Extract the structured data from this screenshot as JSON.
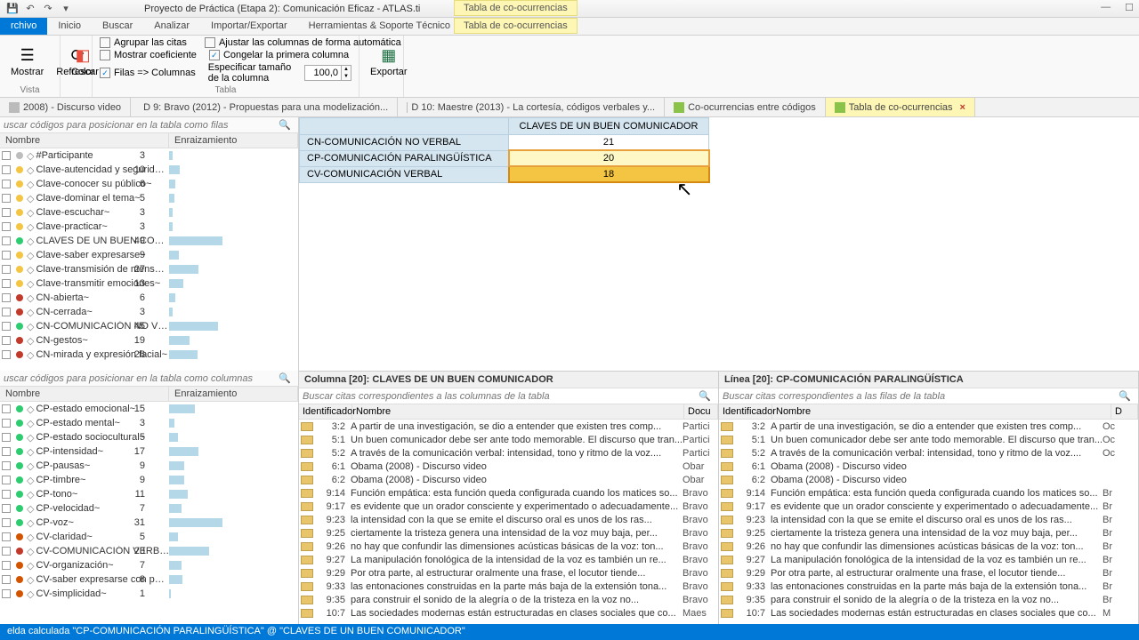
{
  "title": "Proyecto de Práctica (Etapa 2): Comunicación Eficaz - ATLAS.ti",
  "context_tab": "Tabla de co-ocurrencias",
  "menu": {
    "archivo": "rchivo",
    "inicio": "Inicio",
    "buscar": "Buscar",
    "analizar": "Analizar",
    "importar": "Importar/Exportar",
    "herramientas": "Herramientas & Soporte Técnico"
  },
  "ribbon": {
    "mostrar": "Mostrar",
    "vista": "Vista",
    "refrescar": "Refrescar",
    "color": "Color",
    "agrupar": "Agrupar las citas",
    "mostrar_coef": "Mostrar coeficiente",
    "filas_col": "Filas => Columnas",
    "ajustar": "Ajustar las columnas de forma automática",
    "congelar": "Congelar la primera columna",
    "especificar": "Especificar tamaño de la columna",
    "size": "100,0",
    "tabla": "Tabla",
    "exportar": "Exportar"
  },
  "doctabs": [
    "2008) - Discurso video",
    "D 9: Bravo (2012) - Propuestas para una modelización...",
    "D 10: Maestre (2013) - La cortesía, códigos verbales y...",
    "Co-ocurrencias entre códigos",
    "Tabla de co-ocurrencias"
  ],
  "search_rows_ph": "uscar códigos para posicionar en la tabla como filas",
  "search_cols_ph": "uscar códigos para posicionar en la tabla como columnas",
  "hdr_nombre": "Nombre",
  "hdr_enraiz": "Enraizamiento",
  "codes_top": [
    {
      "c": "#bdbdbd",
      "n": "#Participante",
      "v": 3
    },
    {
      "c": "#f4c542",
      "n": "Clave-autencidad y seguridad~",
      "v": 10
    },
    {
      "c": "#f4c542",
      "n": "Clave-conocer su público~",
      "v": 6
    },
    {
      "c": "#f4c542",
      "n": "Clave-dominar el tema~",
      "v": 5
    },
    {
      "c": "#f4c542",
      "n": "Clave-escuchar~",
      "v": 3
    },
    {
      "c": "#f4c542",
      "n": "Clave-practicar~",
      "v": 3
    },
    {
      "c": "#2ecc71",
      "n": "CLAVES DE UN BUEN COMU...",
      "v": 49
    },
    {
      "c": "#f4c542",
      "n": "Clave-saber expresarse~",
      "v": 9
    },
    {
      "c": "#f4c542",
      "n": "Clave-transmisión de mensaje~",
      "v": 27
    },
    {
      "c": "#f4c542",
      "n": "Clave-transmitir emociones~",
      "v": 13
    },
    {
      "c": "#c0392b",
      "n": "CN-abierta~",
      "v": 6
    },
    {
      "c": "#c0392b",
      "n": "CN-cerrada~",
      "v": 3
    },
    {
      "c": "#2ecc71",
      "n": "CN-COMUNICACIÓN NO VE...",
      "v": 45
    },
    {
      "c": "#c0392b",
      "n": "CN-gestos~",
      "v": 19
    },
    {
      "c": "#c0392b",
      "n": "CN-mirada y expresión facial~",
      "v": 26
    }
  ],
  "codes_bottom": [
    {
      "c": "#2ecc71",
      "n": "CP-estado emocional~",
      "v": 15
    },
    {
      "c": "#2ecc71",
      "n": "CP-estado mental~",
      "v": 3
    },
    {
      "c": "#2ecc71",
      "n": "CP-estado sociocultural~",
      "v": 5
    },
    {
      "c": "#2ecc71",
      "n": "CP-intensidad~",
      "v": 17
    },
    {
      "c": "#2ecc71",
      "n": "CP-pausas~",
      "v": 9
    },
    {
      "c": "#2ecc71",
      "n": "CP-timbre~",
      "v": 9
    },
    {
      "c": "#2ecc71",
      "n": "CP-tono~",
      "v": 11
    },
    {
      "c": "#2ecc71",
      "n": "CP-velocidad~",
      "v": 7
    },
    {
      "c": "#2ecc71",
      "n": "CP-voz~",
      "v": 31
    },
    {
      "c": "#d35400",
      "n": "CV-claridad~",
      "v": 5
    },
    {
      "c": "#c0392b",
      "n": "CV-COMUNICACIÓN VERBAL~",
      "v": 23
    },
    {
      "c": "#d35400",
      "n": "CV-organización~",
      "v": 7
    },
    {
      "c": "#d35400",
      "n": "CV-saber expresarse con pal...",
      "v": 8
    },
    {
      "c": "#d35400",
      "n": "CV-simplicidad~",
      "v": 1
    }
  ],
  "co_header": "CLAVES DE UN BUEN COMUNICADOR",
  "co_rows": [
    {
      "label": "CN-COMUNICACIÓN NO VERBAL",
      "val": "21",
      "cls": ""
    },
    {
      "label": "CP-COMUNICACIÓN PARALINGÜÍSTICA",
      "val": "20",
      "cls": "sel1"
    },
    {
      "label": "CV-COMUNICACIÓN VERBAL",
      "val": "18",
      "cls": "sel2"
    }
  ],
  "lp_left_title": "Columna [20]: CLAVES DE UN BUEN COMUNICADOR",
  "lp_right_title": "Línea [20]: CP-COMUNICACIÓN PARALINGÜÍSTICA",
  "lp_left_search": "Buscar citas correspondientes a las columnas de la tabla",
  "lp_right_search": "Buscar citas correspondientes a las filas de la tabla",
  "lp_hdr_id": "Identificador",
  "lp_hdr_nombre": "Nombre",
  "lp_hdr_doc": "Docu",
  "quotes_left": [
    {
      "id": "3:2",
      "n": "A partir de una investigación, se dio a entender que existen tres comp...",
      "d": "Partici"
    },
    {
      "id": "5:1",
      "n": "Un buen comunicador debe ser ante todo memorable. El discurso que tran...",
      "d": "Partici"
    },
    {
      "id": "5:2",
      "n": "A través de la comunicación verbal: intensidad, tono y ritmo de la voz....",
      "d": "Partici"
    },
    {
      "id": "6:1",
      "n": "Obama (2008) - Discurso video",
      "d": "Obar"
    },
    {
      "id": "6:2",
      "n": "Obama (2008) - Discurso video",
      "d": "Obar"
    },
    {
      "id": "9:14",
      "n": "Función empática: esta función queda configurada cuando los matices so...",
      "d": "Bravo"
    },
    {
      "id": "9:17",
      "n": "es evidente que un orador consciente y experimentado o  adecuadamente...",
      "d": "Bravo"
    },
    {
      "id": "9:23",
      "n": "la intensidad con la que se emite el discurso oral es  unos de los ras...",
      "d": "Bravo"
    },
    {
      "id": "9:25",
      "n": "ciertamente la tristeza genera una  intensidad de la voz muy baja, per...",
      "d": "Bravo"
    },
    {
      "id": "9:26",
      "n": "no hay que confundir las dimensiones acústicas básicas de la  voz: ton...",
      "d": "Bravo"
    },
    {
      "id": "9:27",
      "n": "La manipulación fonológica de la intensidad de la voz es también un re...",
      "d": "Bravo"
    },
    {
      "id": "9:29",
      "n": "Por otra parte, al estructurar oralmente una frase, el locutor tiende...",
      "d": "Bravo"
    },
    {
      "id": "9:33",
      "n": "las entonaciones construidas en la parte más baja de la extensión tona...",
      "d": "Bravo"
    },
    {
      "id": "9:35",
      "n": "para construir el sonido de la alegría o de la tristeza en la voz  no...",
      "d": "Bravo"
    },
    {
      "id": "10:7",
      "n": "Las sociedades modernas están estructuradas en clases sociales que co...",
      "d": "Maes"
    }
  ],
  "quotes_right": [
    {
      "id": "3:2",
      "n": "A partir de una investigación, se dio a entender que existen tres comp...",
      "d": "Oc"
    },
    {
      "id": "5:1",
      "n": "Un buen comunicador debe ser ante todo memorable. El discurso que tran...",
      "d": "Oc"
    },
    {
      "id": "5:2",
      "n": "A través de la comunicación verbal: intensidad, tono y ritmo de la voz....",
      "d": "Oc"
    },
    {
      "id": "6:1",
      "n": "Obama (2008) - Discurso video",
      "d": ""
    },
    {
      "id": "6:2",
      "n": "Obama (2008) - Discurso video",
      "d": ""
    },
    {
      "id": "9:14",
      "n": "Función empática: esta función queda configurada cuando los matices so...",
      "d": "Br"
    },
    {
      "id": "9:17",
      "n": "es evidente que un orador consciente y experimentado o  adecuadamente...",
      "d": "Br"
    },
    {
      "id": "9:23",
      "n": "la intensidad con la que se emite el discurso oral es  unos de los ras...",
      "d": "Br"
    },
    {
      "id": "9:25",
      "n": "ciertamente la tristeza genera una  intensidad de la voz muy baja, per...",
      "d": "Br"
    },
    {
      "id": "9:26",
      "n": "no hay que confundir las dimensiones acústicas básicas de la  voz: ton...",
      "d": "Br"
    },
    {
      "id": "9:27",
      "n": "La manipulación fonológica de la intensidad de la voz es también un re...",
      "d": "Br"
    },
    {
      "id": "9:29",
      "n": "Por otra parte, al estructurar oralmente una frase, el locutor tiende...",
      "d": "Br"
    },
    {
      "id": "9:33",
      "n": "las entonaciones construidas en la parte más baja de la extensión tona...",
      "d": "Br"
    },
    {
      "id": "9:35",
      "n": "para construir el sonido de la alegría o de la tristeza en la voz  no...",
      "d": "Br"
    },
    {
      "id": "10:7",
      "n": "Las sociedades modernas están estructuradas en clases sociales que co...",
      "d": "M"
    }
  ],
  "status": "elda calculada \"CP-COMUNICACIÓN PARALINGÜÍSTICA\" @ \"CLAVES DE UN BUEN COMUNICADOR\"",
  "chart_data": {
    "type": "table",
    "title": "CLAVES DE UN BUEN COMUNICADOR",
    "categories": [
      "CN-COMUNICACIÓN NO VERBAL",
      "CP-COMUNICACIÓN PARALINGÜÍSTICA",
      "CV-COMUNICACIÓN VERBAL"
    ],
    "values": [
      21,
      20,
      18
    ]
  }
}
